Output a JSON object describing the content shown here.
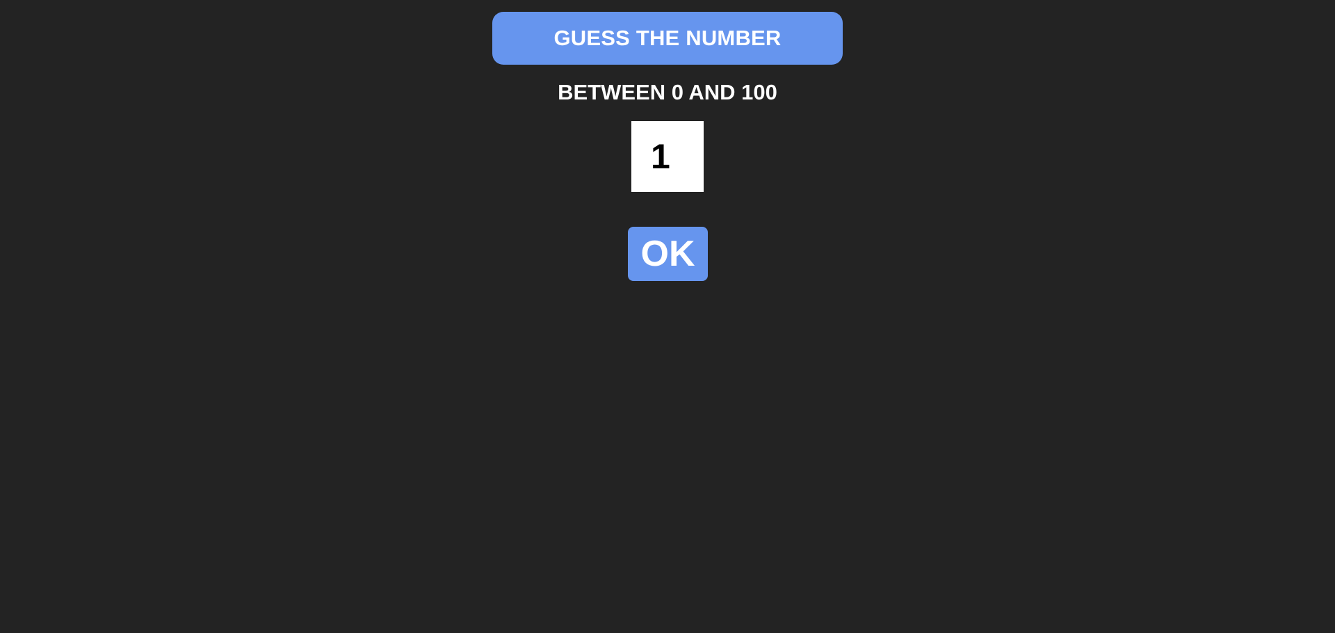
{
  "header": {
    "title": "GUESS THE NUMBER"
  },
  "instructions": {
    "range_text": "BETWEEN 0 AND 100"
  },
  "guess": {
    "value": "1"
  },
  "actions": {
    "ok_label": "OK"
  },
  "colors": {
    "background": "#232323",
    "accent": "#6695ee",
    "text": "#ffffff",
    "input_background": "#ffffff",
    "input_text": "#000000"
  }
}
